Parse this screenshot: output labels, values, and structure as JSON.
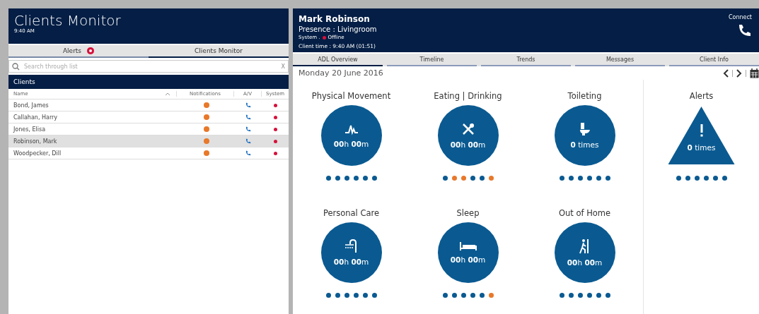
{
  "left": {
    "title": "Clients Monitor",
    "time": "9:40 AM",
    "tabs": [
      {
        "label": "Alerts",
        "selected": false,
        "badge": true
      },
      {
        "label": "Clients Monitor",
        "selected": true,
        "badge": false
      }
    ],
    "search": {
      "placeholder": "Search through list",
      "clear": "X"
    },
    "list_title": "Clients",
    "columns": [
      "Name",
      "Notifications",
      "A/V",
      "System"
    ],
    "rows": [
      {
        "name": "Bond, James",
        "selected": false
      },
      {
        "name": "Callahan, Harry",
        "selected": false
      },
      {
        "name": "Jones, Elisa",
        "selected": false
      },
      {
        "name": "Robinson, Mark",
        "selected": true
      },
      {
        "name": "Woodpecker, Dill",
        "selected": false
      }
    ]
  },
  "client": {
    "name": "Mark Robinson",
    "presence": "Presence :  Livingroom",
    "system_label": "System .",
    "system_status": "Offline",
    "client_time": "Client time : 9:40 AM (01:51)",
    "connect": "Connect"
  },
  "tabs": [
    {
      "label": "ADL Overview",
      "selected": true
    },
    {
      "label": "Timeline",
      "selected": false
    },
    {
      "label": "Trends",
      "selected": false
    },
    {
      "label": "Messages",
      "selected": false
    },
    {
      "label": "Client Info",
      "selected": false
    }
  ],
  "date": "Monday 20 June 2016",
  "tiles": [
    {
      "title": "Physical Movement",
      "kind": "circle",
      "value": "**00**h **00**m",
      "dots": [
        {
          "color": "#0a5a91"
        },
        {
          "color": "#0a5a91"
        },
        {
          "color": "#0a5a91"
        },
        {
          "color": "#0a5a91"
        },
        {
          "color": "#0a5a91"
        },
        {
          "color": "#0a5a91"
        }
      ]
    },
    {
      "title": "Eating | Drinking",
      "kind": "circle",
      "value": "**00**h **00**m",
      "dots": [
        {
          "color": "#0a5a91"
        },
        {
          "color": "#e8782a"
        },
        {
          "color": "#e8782a"
        },
        {
          "color": "#0a5a91"
        },
        {
          "color": "#0a5a91"
        },
        {
          "color": "#e8782a"
        }
      ]
    },
    {
      "title": "Toileting",
      "kind": "circle",
      "value": "**0** times",
      "dots": [
        {
          "color": "#0a5a91"
        },
        {
          "color": "#0a5a91"
        },
        {
          "color": "#0a5a91"
        },
        {
          "color": "#0a5a91"
        },
        {
          "color": "#0a5a91"
        },
        {
          "color": "#0a5a91"
        }
      ]
    },
    {
      "title": "Alerts",
      "kind": "triangle",
      "value": "**0** times",
      "dots": [
        {
          "color": "#0a5a91"
        },
        {
          "color": "#0a5a91"
        },
        {
          "color": "#0a5a91"
        },
        {
          "color": "#0a5a91"
        },
        {
          "color": "#0a5a91"
        },
        {
          "color": "#0a5a91"
        }
      ]
    },
    {
      "title": "Personal Care",
      "kind": "circle",
      "value": "**00**h **00**m",
      "dots": [
        {
          "color": "#0a5a91"
        },
        {
          "color": "#0a5a91"
        },
        {
          "color": "#0a5a91"
        },
        {
          "color": "#0a5a91"
        },
        {
          "color": "#0a5a91"
        },
        {
          "color": "#0a5a91"
        }
      ]
    },
    {
      "title": "Sleep",
      "kind": "circle",
      "value": "**00**h **00**m",
      "dots": [
        {
          "color": "#0a5a91"
        },
        {
          "color": "#0a5a91"
        },
        {
          "color": "#0a5a91"
        },
        {
          "color": "#0a5a91"
        },
        {
          "color": "#0a5a91"
        },
        {
          "color": "#e8782a"
        }
      ]
    },
    {
      "title": "Out of Home",
      "kind": "circle",
      "value": "**00**h **00**m",
      "dots": [
        {
          "color": "#0a5a91"
        },
        {
          "color": "#0a5a91"
        },
        {
          "color": "#0a5a91"
        },
        {
          "color": "#0a5a91"
        },
        {
          "color": "#0a5a91"
        },
        {
          "color": "#0a5a91"
        }
      ]
    }
  ]
}
